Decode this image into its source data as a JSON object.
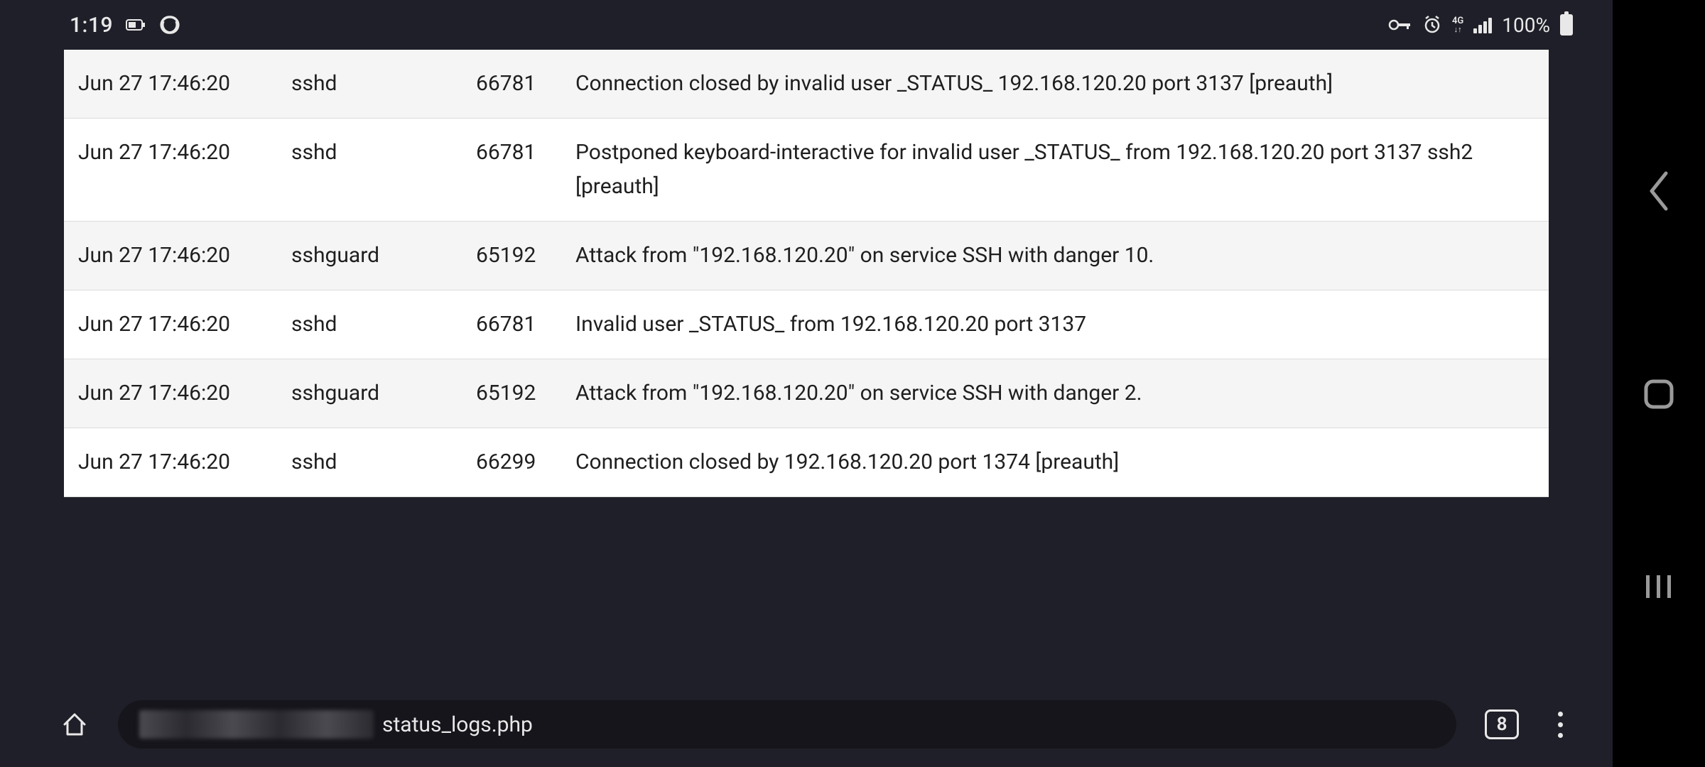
{
  "status_bar": {
    "time": "1:19",
    "battery_pct": "100%"
  },
  "logs": [
    {
      "time": "Jun 27 17:46:20",
      "process": "sshd",
      "pid": "66781",
      "message": "Connection closed by invalid user _STATUS_ 192.168.120.20 port 3137 [preauth]"
    },
    {
      "time": "Jun 27 17:46:20",
      "process": "sshd",
      "pid": "66781",
      "message": "Postponed keyboard-interactive for invalid user _STATUS_ from 192.168.120.20 port 3137 ssh2 [preauth]"
    },
    {
      "time": "Jun 27 17:46:20",
      "process": "sshguard",
      "pid": "65192",
      "message": "Attack from \"192.168.120.20\" on service SSH with danger 10."
    },
    {
      "time": "Jun 27 17:46:20",
      "process": "sshd",
      "pid": "66781",
      "message": "Invalid user _STATUS_ from 192.168.120.20 port 3137"
    },
    {
      "time": "Jun 27 17:46:20",
      "process": "sshguard",
      "pid": "65192",
      "message": "Attack from \"192.168.120.20\" on service SSH with danger 2."
    },
    {
      "time": "Jun 27 17:46:20",
      "process": "sshd",
      "pid": "66299",
      "message": "Connection closed by 192.168.120.20 port 1374 [preauth]"
    }
  ],
  "browser": {
    "url_visible": "status_logs.php",
    "tab_count": "8"
  }
}
